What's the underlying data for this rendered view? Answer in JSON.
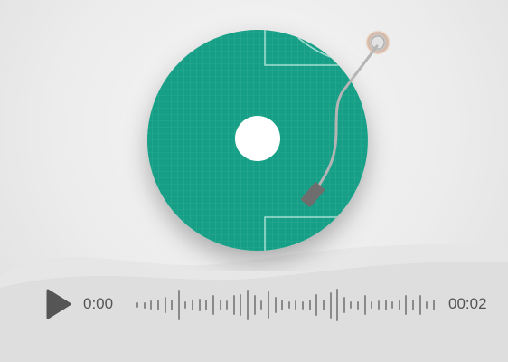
{
  "player": {
    "current_time": "0:00",
    "total_time": "00:02",
    "waveform_levels": [
      0.15,
      0.18,
      0.25,
      0.3,
      0.45,
      0.3,
      0.85,
      0.2,
      0.3,
      0.35,
      0.3,
      0.55,
      0.3,
      0.25,
      0.55,
      0.6,
      0.85,
      0.55,
      0.25,
      0.75,
      0.45,
      0.3,
      0.2,
      0.25,
      0.22,
      0.3,
      0.6,
      0.3,
      0.72,
      0.9,
      0.45,
      0.2,
      0.22,
      0.55,
      0.2,
      0.25,
      0.3,
      0.2,
      0.3,
      0.55,
      0.3,
      0.55,
      0.2,
      0.3
    ]
  },
  "colors": {
    "record": "#169f86",
    "grid": "#58c2ad",
    "tonearm": "#b5b5b5",
    "controls": "#555555"
  },
  "icons": {
    "play": "play-icon",
    "record": "vinyl-record-icon",
    "tonearm": "tonearm-icon"
  }
}
